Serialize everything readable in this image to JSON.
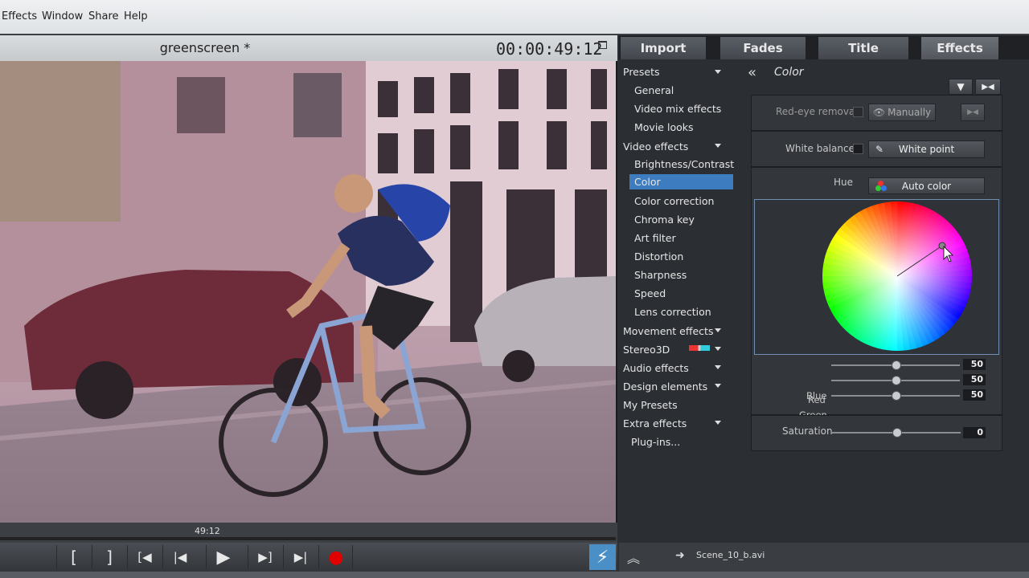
{
  "menu": [
    "Effects",
    "Window",
    "Share",
    "Help"
  ],
  "preview": {
    "title": "greenscreen *",
    "timecode": "00:00:49:12",
    "scrub_time": "49:12"
  },
  "transport": {
    "icons": [
      "mark-in-icon",
      "mark-out-icon",
      "go-to-start-icon",
      "previous-frame-icon",
      "play-icon",
      "next-frame-icon",
      "go-to-end-icon",
      "record-icon"
    ],
    "glyphs": [
      "[",
      "]",
      "[◀",
      "|◀",
      "▶",
      "▶]",
      "▶|",
      "●"
    ],
    "record_color": "#e00000"
  },
  "tabs": [
    {
      "label": "Import",
      "active": false
    },
    {
      "label": "Fades",
      "active": false
    },
    {
      "label": "Title",
      "active": false
    },
    {
      "label": "Effects",
      "active": true
    }
  ],
  "categories": [
    {
      "label": "Presets",
      "level": 0,
      "expandable": true
    },
    {
      "label": "General",
      "level": 1
    },
    {
      "label": "Video mix effects",
      "level": 1
    },
    {
      "label": "Movie looks",
      "level": 1
    },
    {
      "label": "Video effects",
      "level": 0,
      "expandable": true
    },
    {
      "label": "Brightness/Contrast",
      "level": 1
    },
    {
      "label": "Color",
      "level": 1,
      "selected": true
    },
    {
      "label": "Color correction",
      "level": 1
    },
    {
      "label": "Chroma key",
      "level": 1
    },
    {
      "label": "Art filter",
      "level": 1
    },
    {
      "label": "Distortion",
      "level": 1
    },
    {
      "label": "Sharpness",
      "level": 1
    },
    {
      "label": "Speed",
      "level": 1
    },
    {
      "label": "Lens correction",
      "level": 1
    },
    {
      "label": "Movement effects",
      "level": 0,
      "expandable": true
    },
    {
      "label": "Stereo3D",
      "level": 0,
      "expandable": true
    },
    {
      "label": "Audio effects",
      "level": 0,
      "expandable": true
    },
    {
      "label": "Design elements",
      "level": 0,
      "expandable": true
    },
    {
      "label": "My Presets",
      "level": 0
    },
    {
      "label": "Extra effects",
      "level": 0,
      "expandable": true
    },
    {
      "label": "Plug-ins...",
      "level": 1
    }
  ],
  "panel": {
    "title": "Color",
    "red_eye": {
      "label": "Red-eye removal",
      "button": "Manually"
    },
    "white_balance": {
      "label": "White balance",
      "button": "White point"
    },
    "hue": {
      "label": "Hue",
      "button": "Auto color"
    },
    "rgb": [
      {
        "name": "Red",
        "value": "50"
      },
      {
        "name": "Green",
        "value": "50"
      },
      {
        "name": "Blue",
        "value": "50"
      }
    ],
    "saturation": {
      "label": "Saturation",
      "value": "0"
    }
  },
  "status": {
    "filename": "Scene_10_b.avi"
  }
}
